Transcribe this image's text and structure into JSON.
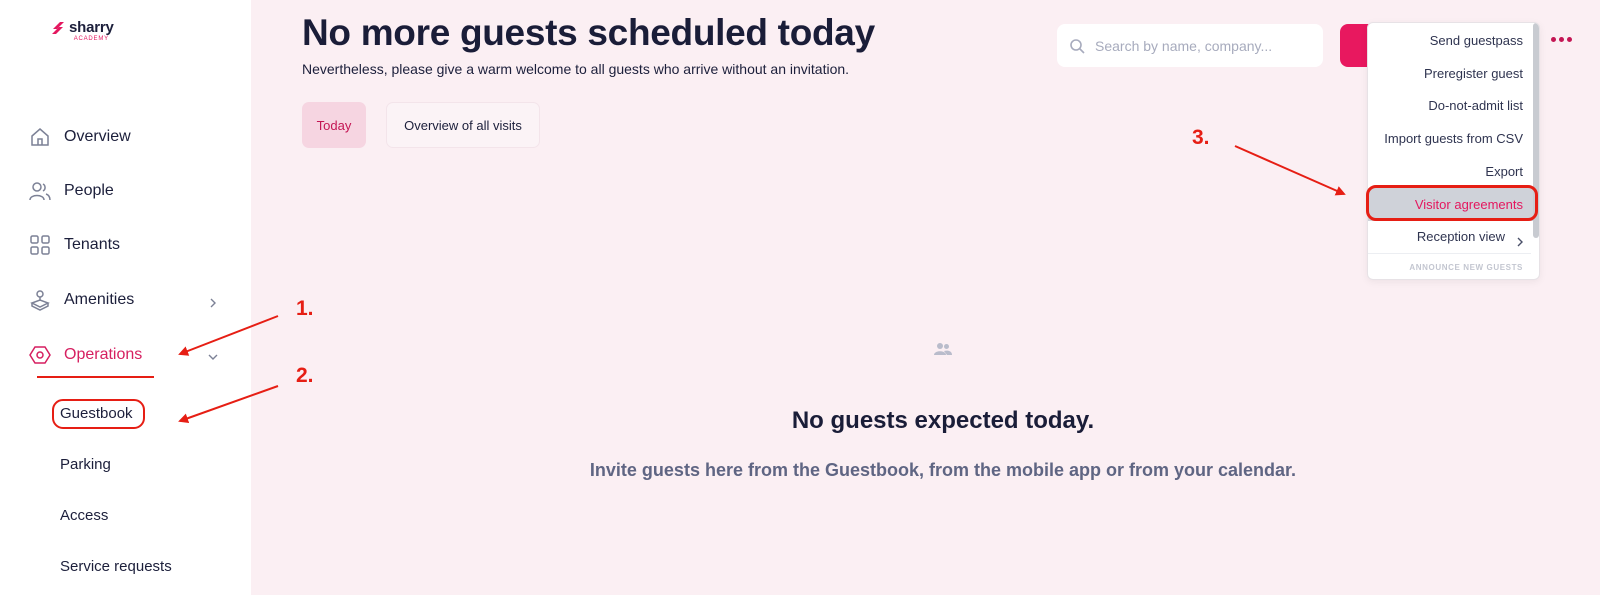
{
  "brand": {
    "name": "sharry",
    "sub": "ACADEMY",
    "accent": "#e4175f"
  },
  "sidebar": {
    "items": [
      {
        "label": "Overview",
        "icon": "home-icon"
      },
      {
        "label": "People",
        "icon": "people-icon"
      },
      {
        "label": "Tenants",
        "icon": "grid-icon"
      },
      {
        "label": "Amenities",
        "icon": "amenities-icon"
      },
      {
        "label": "Operations",
        "icon": "hexagon-icon",
        "active": true
      }
    ],
    "sub_items": [
      "Guestbook",
      "Parking",
      "Access",
      "Service requests"
    ]
  },
  "page": {
    "title": "No more guests scheduled today",
    "subtitle": "Nevertheless, please give a warm welcome to all guests who arrive without an invitation."
  },
  "tabs": {
    "today": "Today",
    "overview": "Overview of all visits"
  },
  "search": {
    "placeholder": "Search by name, company..."
  },
  "menu": {
    "items": [
      "Send guestpass",
      "Preregister guest",
      "Do-not-admit list",
      "Import guests from CSV",
      "Export",
      "Visitor agreements",
      "Reception view"
    ],
    "section": "ANNOUNCE NEW GUESTS"
  },
  "empty": {
    "title": "No guests expected today.",
    "subtitle": "Invite guests here from the Guestbook, from the mobile app or from your calendar."
  },
  "annotations": {
    "one": "1.",
    "two": "2.",
    "three": "3."
  }
}
